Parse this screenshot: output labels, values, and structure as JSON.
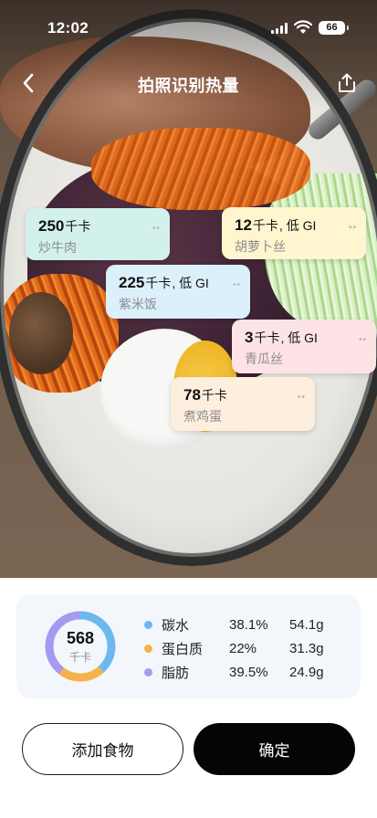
{
  "status_bar": {
    "time": "12:02",
    "battery": "66",
    "icons": [
      "signal-icon",
      "wifi-icon",
      "battery-icon"
    ]
  },
  "nav": {
    "title": "拍照识别热量",
    "back_icon": "chevron-left-icon",
    "share_icon": "share-icon"
  },
  "food_tags": [
    {
      "calories": "250",
      "unit": "千卡",
      "gi": "",
      "name": "炒牛肉",
      "color": "#d3f1ec"
    },
    {
      "calories": "12",
      "unit": "千卡",
      "gi": ", 低 GI",
      "name": "胡萝卜丝",
      "color": "#fff5cf"
    },
    {
      "calories": "225",
      "unit": "千卡",
      "gi": ", 低 GI",
      "name": "紫米饭",
      "color": "#dcf0fb"
    },
    {
      "calories": "3",
      "unit": "千卡",
      "gi": ", 低 GI",
      "name": "青瓜丝",
      "color": "#fde3e6"
    },
    {
      "calories": "78",
      "unit": "千卡",
      "gi": "",
      "name": "煮鸡蛋",
      "color": "#fdeedd"
    }
  ],
  "nutrition": {
    "total": "568",
    "unit": "千卡",
    "items": [
      {
        "name": "碳水",
        "percent": "38.1%",
        "grams": "54.1g",
        "color": "#6db8f0",
        "fraction": 0.381
      },
      {
        "name": "蛋白质",
        "percent": "22%",
        "grams": "31.3g",
        "color": "#f5b24a",
        "fraction": 0.22
      },
      {
        "name": "脂肪",
        "percent": "39.5%",
        "grams": "24.9g",
        "color": "#a59af0",
        "fraction": 0.395
      }
    ]
  },
  "actions": {
    "add_food": "添加食物",
    "confirm": "确定"
  }
}
